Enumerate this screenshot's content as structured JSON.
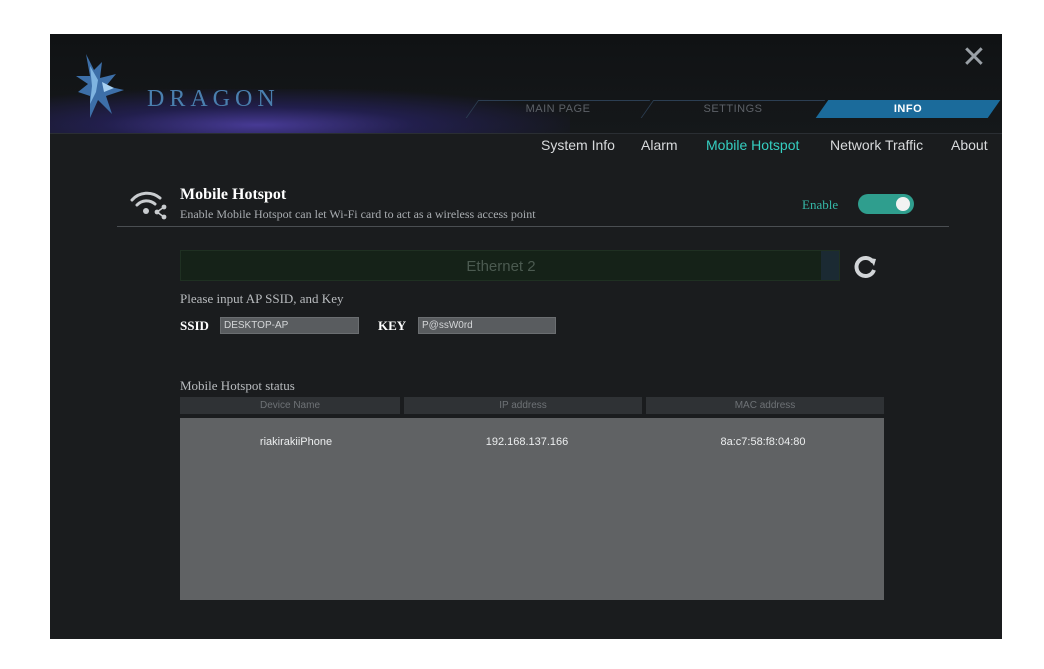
{
  "app": {
    "logo_text": "DRAGON"
  },
  "window_controls": {
    "close_label": "✕"
  },
  "main_tabs": [
    {
      "label": "MAIN PAGE",
      "active": false
    },
    {
      "label": "SETTINGS",
      "active": false
    },
    {
      "label": "INFO",
      "active": true
    }
  ],
  "sub_tabs": [
    {
      "label": "System Info",
      "active": false
    },
    {
      "label": "Alarm",
      "active": false
    },
    {
      "label": "Mobile Hotspot",
      "active": true
    },
    {
      "label": "Network Traffic",
      "active": false
    },
    {
      "label": "About",
      "active": false
    }
  ],
  "section": {
    "icon": "wifi-share-icon",
    "title": "Mobile Hotspot",
    "description": "Enable Mobile Hotspot can let Wi-Fi card to act as a wireless access point",
    "enable_label": "Enable",
    "enabled": true
  },
  "adapter": {
    "selected": "Ethernet 2",
    "refresh_icon": "refresh-icon"
  },
  "credentials": {
    "prompt": "Please input AP SSID, and Key",
    "ssid_label": "SSID",
    "ssid_value": "DESKTOP-AP",
    "key_label": "KEY",
    "key_value": "P@ssW0rd"
  },
  "status": {
    "label": "Mobile Hotspot status",
    "columns": [
      "Device Name",
      "IP address",
      "MAC address"
    ],
    "rows": [
      [
        "riakirakiiPhone",
        "192.168.137.166",
        "8a:c7:58:f8:04:80"
      ]
    ]
  },
  "colors": {
    "accent": "#35cfc1",
    "toggle_on": "#2f9e8e",
    "active_tab": "#1b6b9b",
    "window_bg": "#1a1c1e"
  }
}
